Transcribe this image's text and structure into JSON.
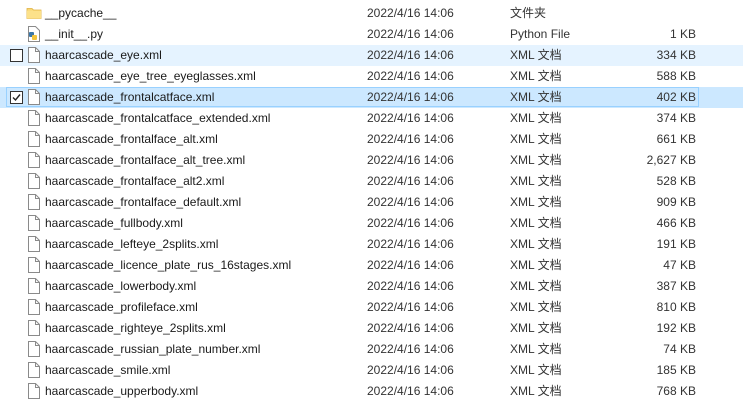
{
  "files": [
    {
      "name": "__pycache__",
      "date": "2022/4/16 14:06",
      "type": "文件夹",
      "size": "",
      "icon": "folder-icon",
      "state": "normal"
    },
    {
      "name": "__init__.py",
      "date": "2022/4/16 14:06",
      "type": "Python File",
      "size": "1 KB",
      "icon": "python-file-icon",
      "state": "normal"
    },
    {
      "name": "haarcascade_eye.xml",
      "date": "2022/4/16 14:06",
      "type": "XML 文档",
      "size": "334 KB",
      "icon": "document-icon",
      "state": "hover",
      "checked": false
    },
    {
      "name": "haarcascade_eye_tree_eyeglasses.xml",
      "date": "2022/4/16 14:06",
      "type": "XML 文档",
      "size": "588 KB",
      "icon": "document-icon",
      "state": "normal"
    },
    {
      "name": "haarcascade_frontalcatface.xml",
      "date": "2022/4/16 14:06",
      "type": "XML 文档",
      "size": "402 KB",
      "icon": "document-icon",
      "state": "selected",
      "checked": true
    },
    {
      "name": "haarcascade_frontalcatface_extended.xml",
      "date": "2022/4/16 14:06",
      "type": "XML 文档",
      "size": "374 KB",
      "icon": "document-icon",
      "state": "normal"
    },
    {
      "name": "haarcascade_frontalface_alt.xml",
      "date": "2022/4/16 14:06",
      "type": "XML 文档",
      "size": "661 KB",
      "icon": "document-icon",
      "state": "normal"
    },
    {
      "name": "haarcascade_frontalface_alt_tree.xml",
      "date": "2022/4/16 14:06",
      "type": "XML 文档",
      "size": "2,627 KB",
      "icon": "document-icon",
      "state": "normal"
    },
    {
      "name": "haarcascade_frontalface_alt2.xml",
      "date": "2022/4/16 14:06",
      "type": "XML 文档",
      "size": "528 KB",
      "icon": "document-icon",
      "state": "normal"
    },
    {
      "name": "haarcascade_frontalface_default.xml",
      "date": "2022/4/16 14:06",
      "type": "XML 文档",
      "size": "909 KB",
      "icon": "document-icon",
      "state": "normal"
    },
    {
      "name": "haarcascade_fullbody.xml",
      "date": "2022/4/16 14:06",
      "type": "XML 文档",
      "size": "466 KB",
      "icon": "document-icon",
      "state": "normal"
    },
    {
      "name": "haarcascade_lefteye_2splits.xml",
      "date": "2022/4/16 14:06",
      "type": "XML 文档",
      "size": "191 KB",
      "icon": "document-icon",
      "state": "normal"
    },
    {
      "name": "haarcascade_licence_plate_rus_16stages.xml",
      "date": "2022/4/16 14:06",
      "type": "XML 文档",
      "size": "47 KB",
      "icon": "document-icon",
      "state": "normal"
    },
    {
      "name": "haarcascade_lowerbody.xml",
      "date": "2022/4/16 14:06",
      "type": "XML 文档",
      "size": "387 KB",
      "icon": "document-icon",
      "state": "normal"
    },
    {
      "name": "haarcascade_profileface.xml",
      "date": "2022/4/16 14:06",
      "type": "XML 文档",
      "size": "810 KB",
      "icon": "document-icon",
      "state": "normal"
    },
    {
      "name": "haarcascade_righteye_2splits.xml",
      "date": "2022/4/16 14:06",
      "type": "XML 文档",
      "size": "192 KB",
      "icon": "document-icon",
      "state": "normal"
    },
    {
      "name": "haarcascade_russian_plate_number.xml",
      "date": "2022/4/16 14:06",
      "type": "XML 文档",
      "size": "74 KB",
      "icon": "document-icon",
      "state": "normal"
    },
    {
      "name": "haarcascade_smile.xml",
      "date": "2022/4/16 14:06",
      "type": "XML 文档",
      "size": "185 KB",
      "icon": "document-icon",
      "state": "normal"
    },
    {
      "name": "haarcascade_upperbody.xml",
      "date": "2022/4/16 14:06",
      "type": "XML 文档",
      "size": "768 KB",
      "icon": "document-icon",
      "state": "normal"
    }
  ],
  "colors": {
    "hover_bg": "#e5f3ff",
    "selected_bg": "#cce8ff",
    "selected_border": "#99d1ff",
    "folder": "#f8d775"
  }
}
